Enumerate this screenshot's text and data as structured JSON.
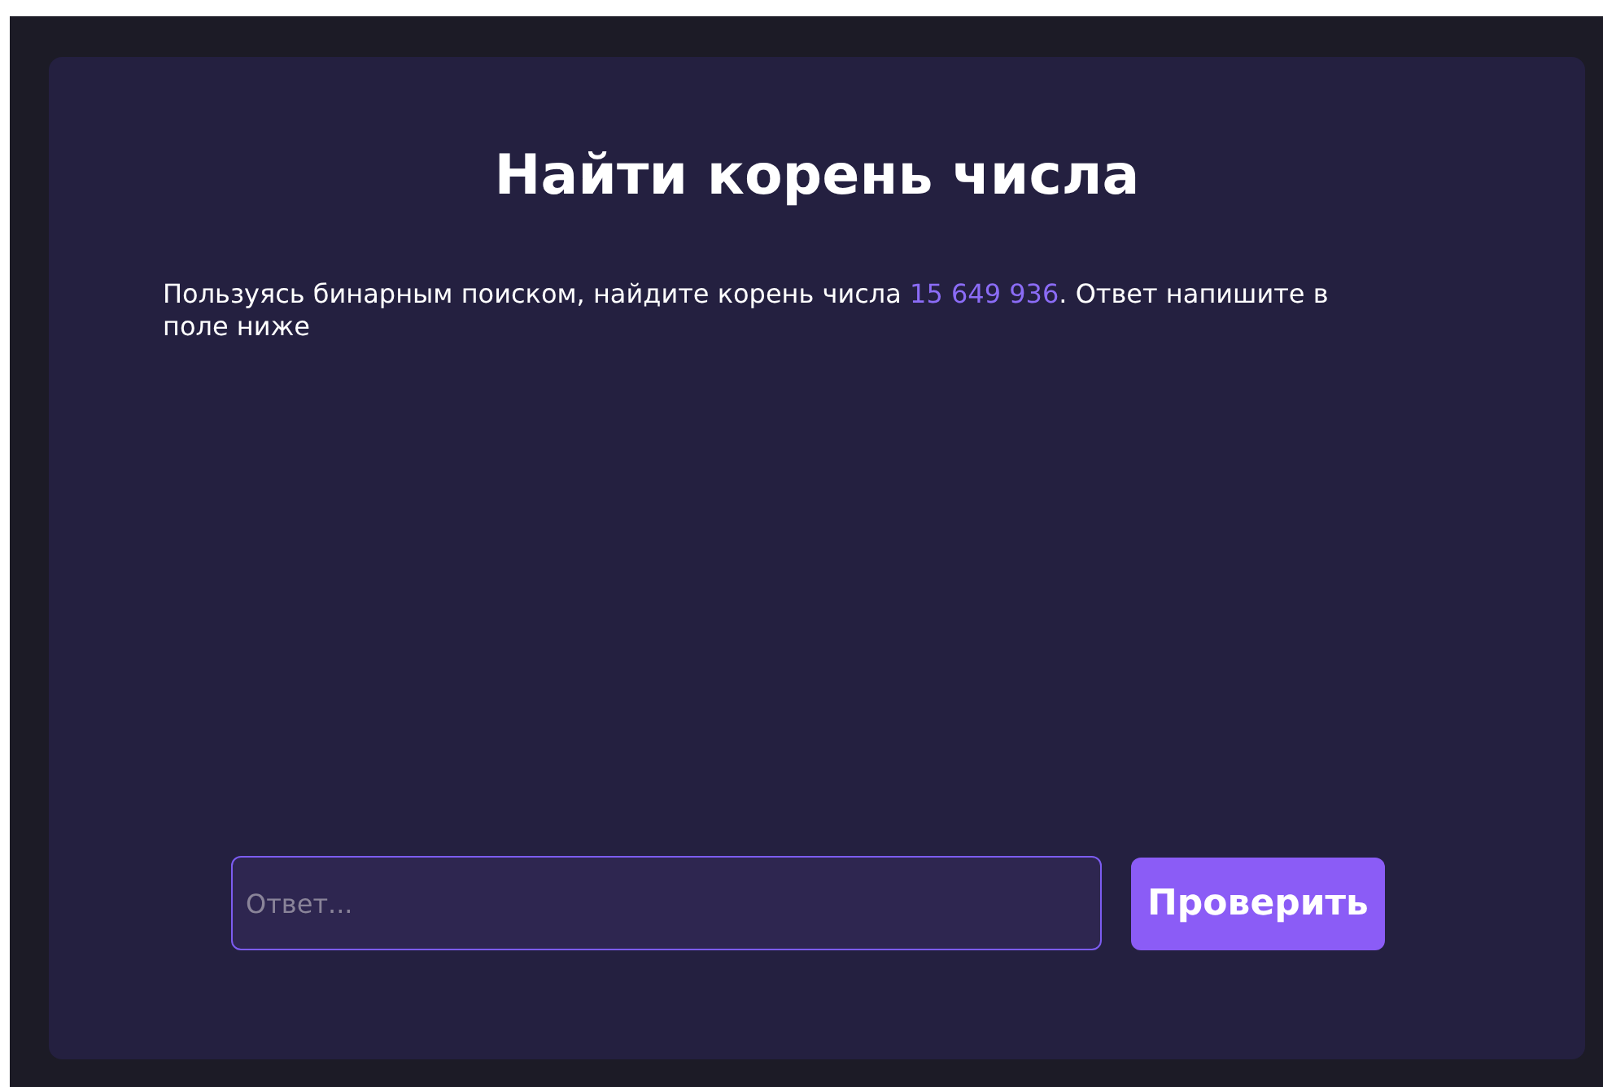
{
  "title": "Найти корень числа",
  "prompt": {
    "before": "Пользуясь бинарным поиском, найдите корень числа ",
    "highlight": "15 649 936",
    "after": ". Ответ напишите в поле ниже"
  },
  "answer": {
    "placeholder": "Ответ..."
  },
  "submit": {
    "label": "Проверить"
  }
}
